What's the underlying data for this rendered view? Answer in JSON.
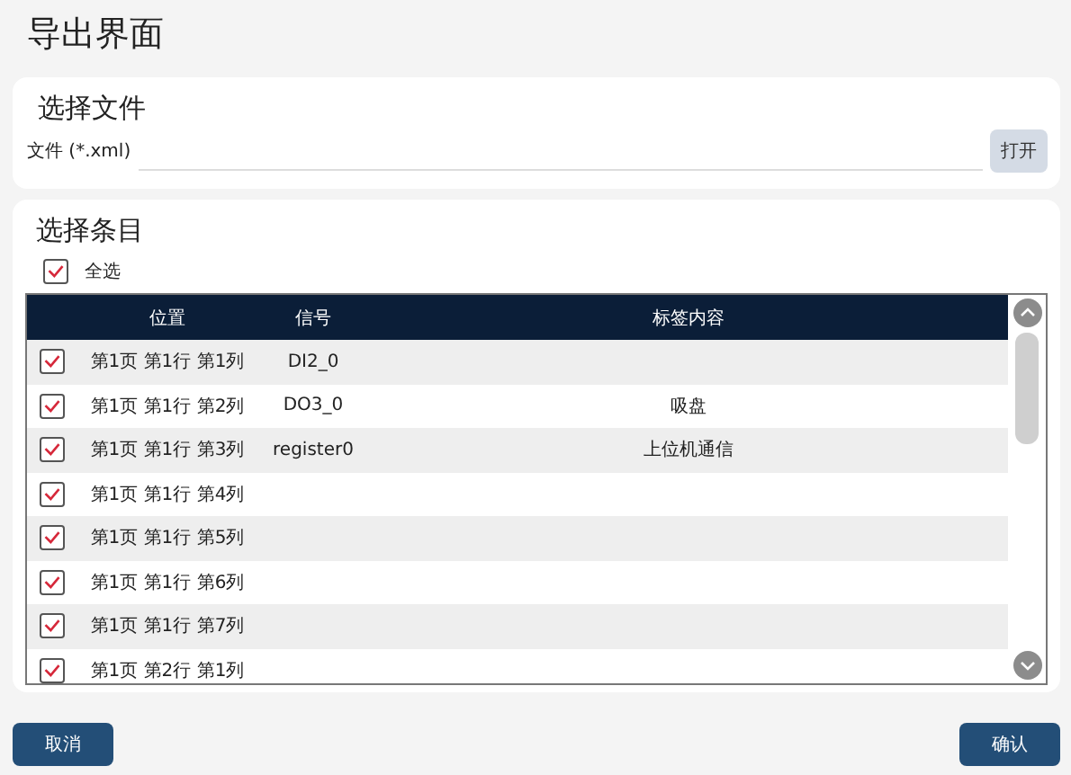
{
  "window": {
    "title": "导出界面"
  },
  "file_section": {
    "title": "选择文件",
    "field_label": "文件 (*.xml)",
    "open_button": "打开"
  },
  "items_section": {
    "title": "选择条目",
    "select_all": {
      "label": "全选",
      "checked": true
    }
  },
  "table": {
    "columns": [
      "位置",
      "信号",
      "标签内容"
    ],
    "rows": [
      {
        "checked": true,
        "position": "第1页 第1行 第1列",
        "signal": "DI2_0"
      },
      {
        "checked": true,
        "position": "第1页 第1行 第2列",
        "signal": "DO3_0",
        "label": "吸盘"
      },
      {
        "checked": true,
        "position": "第1页 第1行 第3列",
        "signal": "register0",
        "label": "上位机通信"
      },
      {
        "checked": true,
        "position": "第1页 第1行 第4列"
      },
      {
        "checked": true,
        "position": "第1页 第1行 第5列"
      },
      {
        "checked": true,
        "position": "第1页 第1行 第6列"
      },
      {
        "checked": true,
        "position": "第1页 第1行 第7列"
      },
      {
        "checked": true,
        "position": "第1页 第2行 第1列"
      }
    ]
  },
  "buttons": {
    "cancel": "取消",
    "confirm": "确认"
  }
}
